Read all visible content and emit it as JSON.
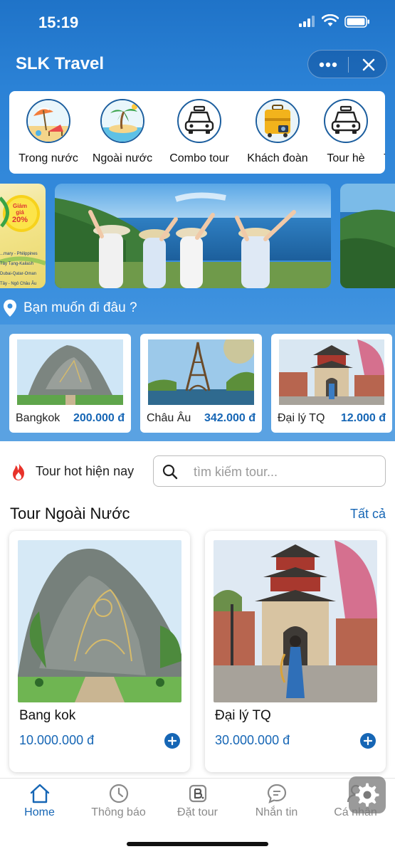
{
  "status_bar": {
    "time": "15:19"
  },
  "app": {
    "title": "SLK Travel"
  },
  "categories": [
    {
      "label": "Trong nước",
      "icon": "beach-chair-icon"
    },
    {
      "label": "Ngoài nước",
      "icon": "palm-island-icon"
    },
    {
      "label": "Combo tour",
      "icon": "car-icon"
    },
    {
      "label": "Khách đoàn",
      "icon": "luggage-icon"
    },
    {
      "label": "Tour hè",
      "icon": "car-icon"
    },
    {
      "label": "T",
      "icon": "partial-icon"
    }
  ],
  "promo_banner": {
    "badge_line1": "Giảm",
    "badge_line2": "giá",
    "badge_line3": "20%",
    "lines": [
      "...mary - Philippines",
      "Tây Tạng-Kailash",
      "Dubai-Qatar-Oman",
      "Tây - Ngô Châu Âu"
    ]
  },
  "where_prompt": "Bạn muốn đi đâu ?",
  "destinations": [
    {
      "name": "Bangkok",
      "price": "200.000 đ"
    },
    {
      "name": "Châu Âu",
      "price": "342.000 đ"
    },
    {
      "name": "Đại lý TQ",
      "price": "12.000 đ"
    }
  ],
  "hot_tour_label": "Tour hot hiện nay",
  "search": {
    "placeholder": "tìm kiếm tour..."
  },
  "section": {
    "title": "Tour Ngoài Nước",
    "see_all": "Tất cả"
  },
  "tours": [
    {
      "name": "Bang kok",
      "price": "10.000.000 đ"
    },
    {
      "name": "Đại lý TQ",
      "price": "30.000.000 đ"
    }
  ],
  "tabs": [
    {
      "label": "Home",
      "icon": "home-icon",
      "active": true
    },
    {
      "label": "Thông báo",
      "icon": "clock-icon",
      "active": false
    },
    {
      "label": "Đặt tour",
      "icon": "booking-icon",
      "active": false
    },
    {
      "label": "Nhắn tin",
      "icon": "chat-icon",
      "active": false
    },
    {
      "label": "Cá nhân",
      "icon": "user-icon",
      "active": false
    }
  ],
  "colors": {
    "primary": "#1666b5",
    "header_top": "#1f73c8",
    "header_bottom": "#5ca4e4"
  }
}
